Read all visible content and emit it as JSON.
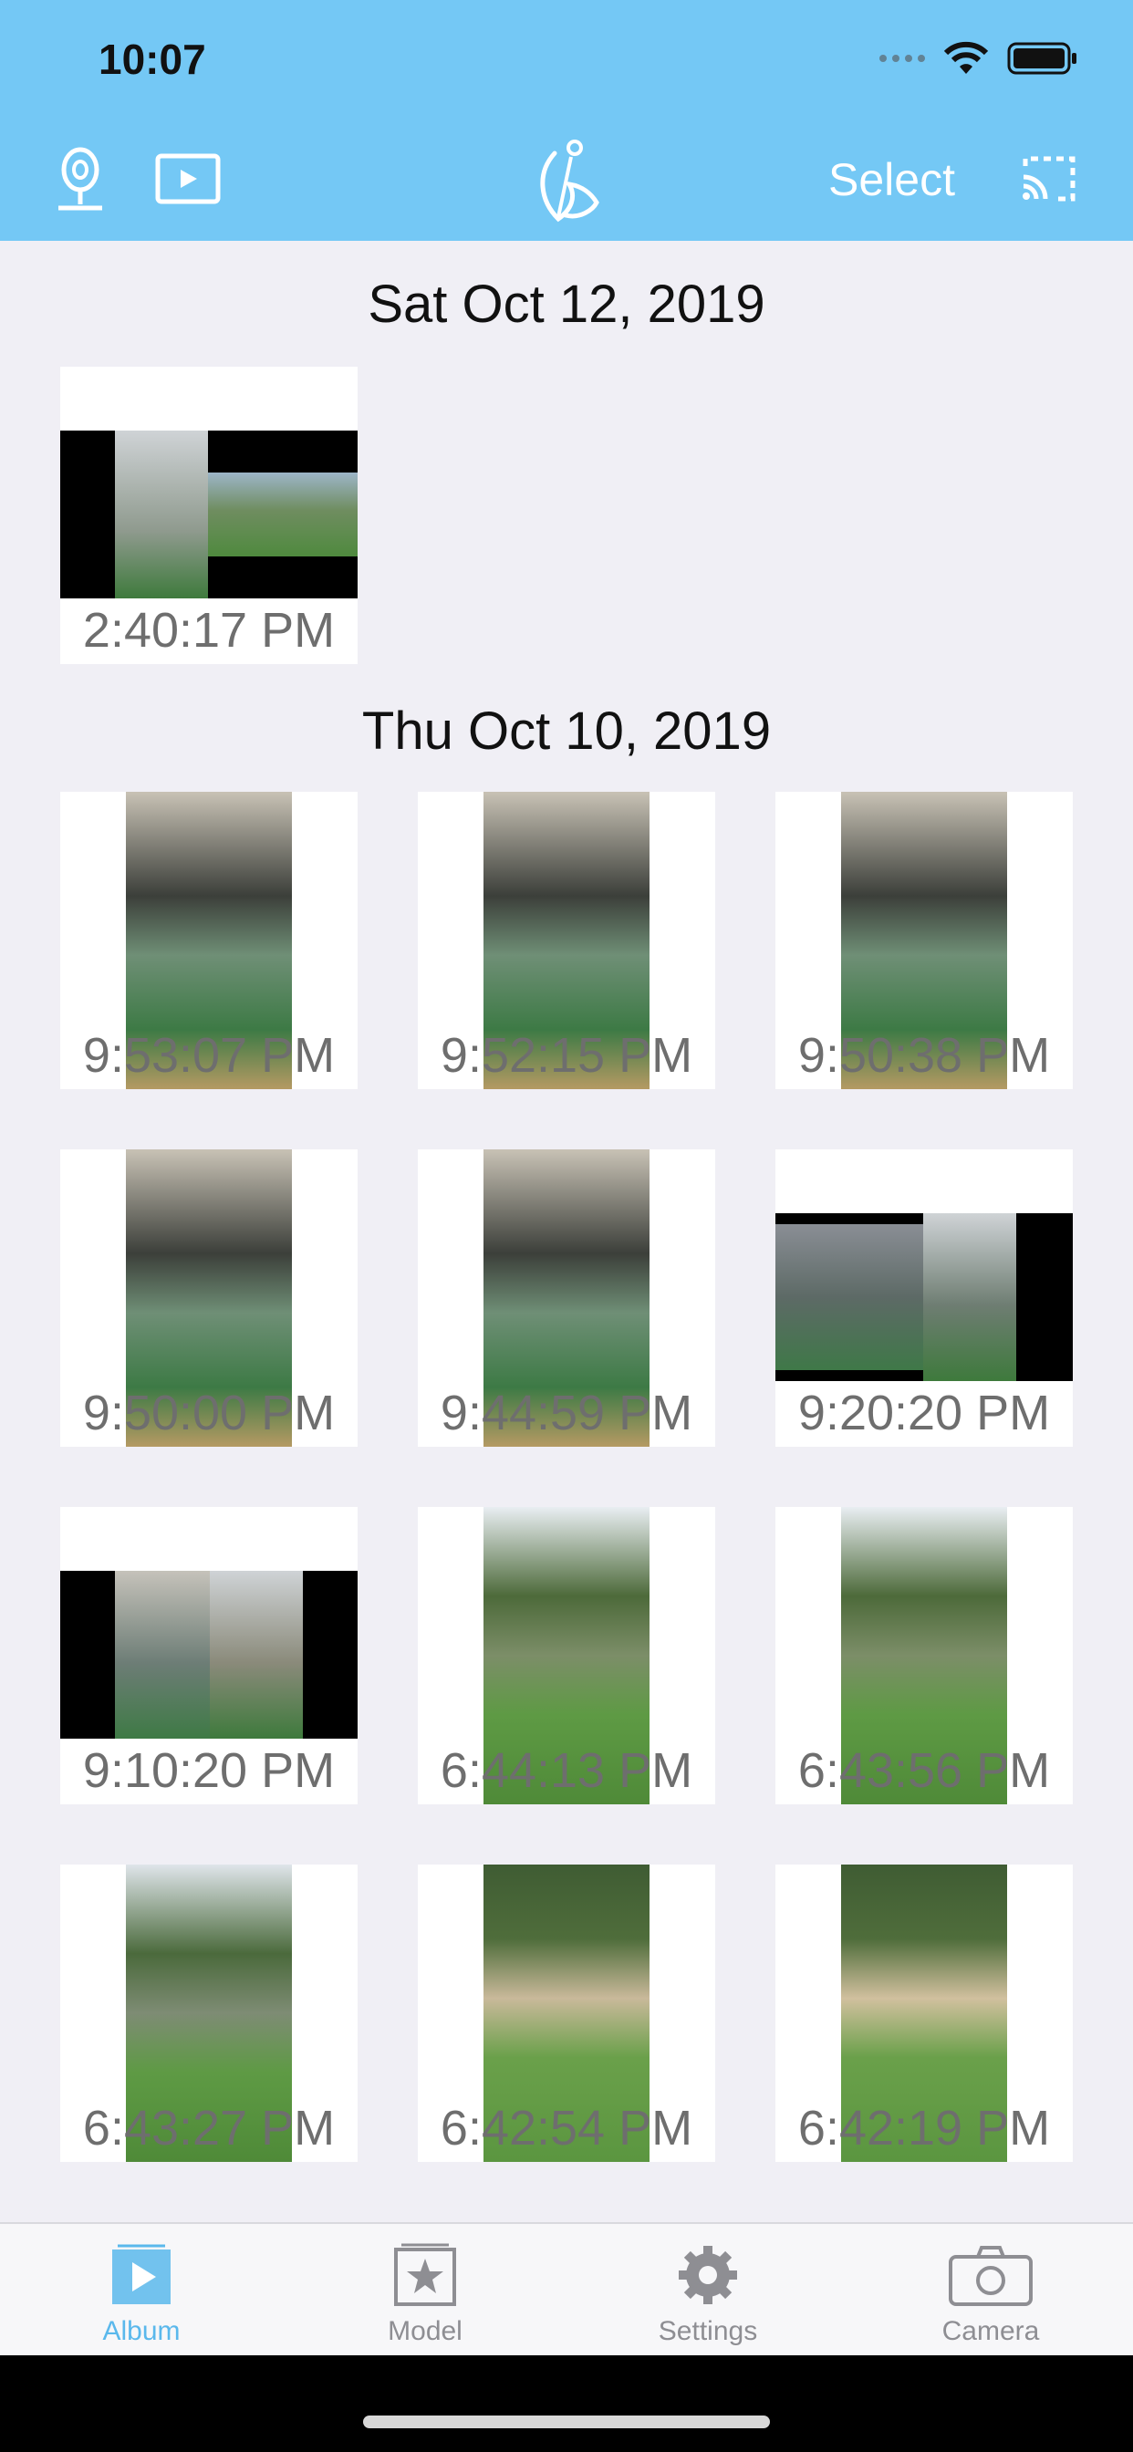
{
  "status_bar": {
    "time": "10:07"
  },
  "toolbar": {
    "left_icons": [
      "webcam-icon",
      "play-rect-icon"
    ],
    "center_icon": "golfer-logo-icon",
    "select_label": "Select",
    "right_icon": "cast-icon"
  },
  "sections": [
    {
      "date": "Sat Oct 12, 2019",
      "items": [
        {
          "time": "2:40:17 PM"
        }
      ]
    },
    {
      "date": "Thu Oct 10, 2019",
      "items": [
        {
          "time": "9:53:07 PM"
        },
        {
          "time": "9:52:15 PM"
        },
        {
          "time": "9:50:38 PM"
        },
        {
          "time": "9:50:00 PM"
        },
        {
          "time": "9:44:59 PM"
        },
        {
          "time": "9:20:20 PM"
        },
        {
          "time": "9:10:20 PM"
        },
        {
          "time": "6:44:13 PM"
        },
        {
          "time": "6:43:56 PM"
        },
        {
          "time": "6:43:27 PM"
        },
        {
          "time": "6:42:54 PM"
        },
        {
          "time": "6:42:19 PM"
        }
      ]
    }
  ],
  "tabbar": {
    "tabs": [
      {
        "label": "Album",
        "icon": "play-square-icon",
        "active": true
      },
      {
        "label": "Model",
        "icon": "star-frame-icon",
        "active": false
      },
      {
        "label": "Settings",
        "icon": "gear-icon",
        "active": false
      },
      {
        "label": "Camera",
        "icon": "camera-icon",
        "active": false
      }
    ]
  },
  "colors": {
    "header": "#74c8f5",
    "active_tab": "#5ab8ec",
    "inactive_tab": "#8e8e93"
  }
}
